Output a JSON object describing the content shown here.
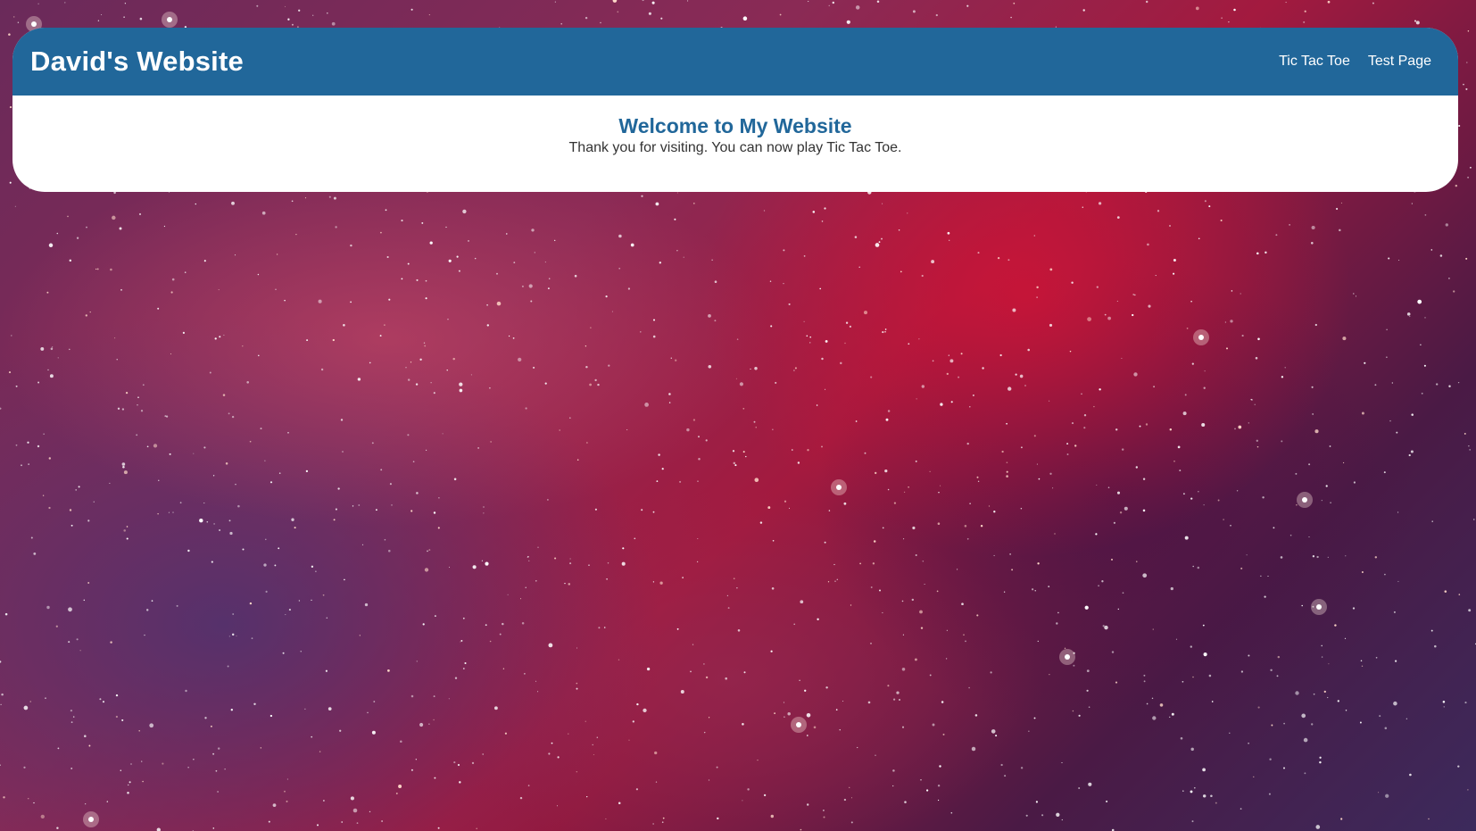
{
  "header": {
    "site_title": "David's Website",
    "nav_links": [
      {
        "label": "Tic Tac Toe"
      },
      {
        "label": "Test Page"
      }
    ]
  },
  "main": {
    "heading": "Welcome to My Website",
    "message": "Thank you for visiting. You can now play Tic Tac Toe."
  },
  "colors": {
    "navbar_background": "#21679a",
    "heading_color": "#21679a",
    "card_background": "#ffffff"
  }
}
